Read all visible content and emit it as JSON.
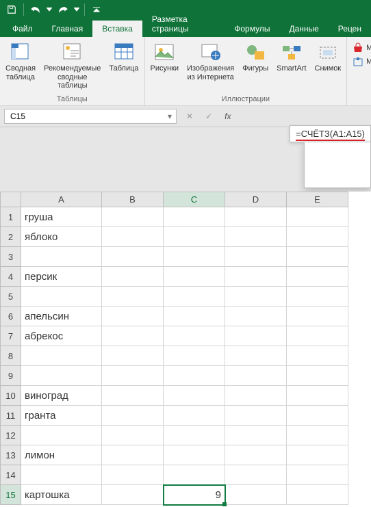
{
  "titlebar": {
    "icons": [
      "save",
      "undo",
      "redo",
      "dropdown"
    ]
  },
  "tabs": {
    "file": "Файл",
    "home": "Главная",
    "insert": "Вставка",
    "layout": "Разметка страницы",
    "formulas": "Формулы",
    "data": "Данные",
    "review": "Рецен"
  },
  "ribbon": {
    "tables": {
      "pivot": "Сводная\nтаблица",
      "recommended": "Рекомендуемые\nсводные таблицы",
      "table": "Таблица",
      "group": "Таблицы"
    },
    "illus": {
      "pictures": "Рисунки",
      "online": "Изображения\nиз Интернета",
      "shapes": "Фигуры",
      "smartart": "SmartArt",
      "screenshot": "Снимок",
      "group": "Иллюстрации"
    },
    "side": {
      "store": "Ма",
      "my": "Мс"
    }
  },
  "formula_bar": {
    "cell_ref": "C15",
    "fx": "fx",
    "formula": "=СЧЁТЗ(A1:A15)"
  },
  "grid": {
    "cols": [
      "A",
      "B",
      "C",
      "D",
      "E"
    ],
    "rows": [
      {
        "n": "1",
        "A": "груша"
      },
      {
        "n": "2",
        "A": "яблоко"
      },
      {
        "n": "3",
        "A": ""
      },
      {
        "n": "4",
        "A": "персик"
      },
      {
        "n": "5",
        "A": ""
      },
      {
        "n": "6",
        "A": "апельсин"
      },
      {
        "n": "7",
        "A": "абрекос"
      },
      {
        "n": "8",
        "A": ""
      },
      {
        "n": "9",
        "A": ""
      },
      {
        "n": "10",
        "A": "виноград"
      },
      {
        "n": "11",
        "A": "гранта"
      },
      {
        "n": "12",
        "A": ""
      },
      {
        "n": "13",
        "A": "лимон"
      },
      {
        "n": "14",
        "A": ""
      },
      {
        "n": "15",
        "A": "картошка",
        "C": "9"
      }
    ]
  }
}
